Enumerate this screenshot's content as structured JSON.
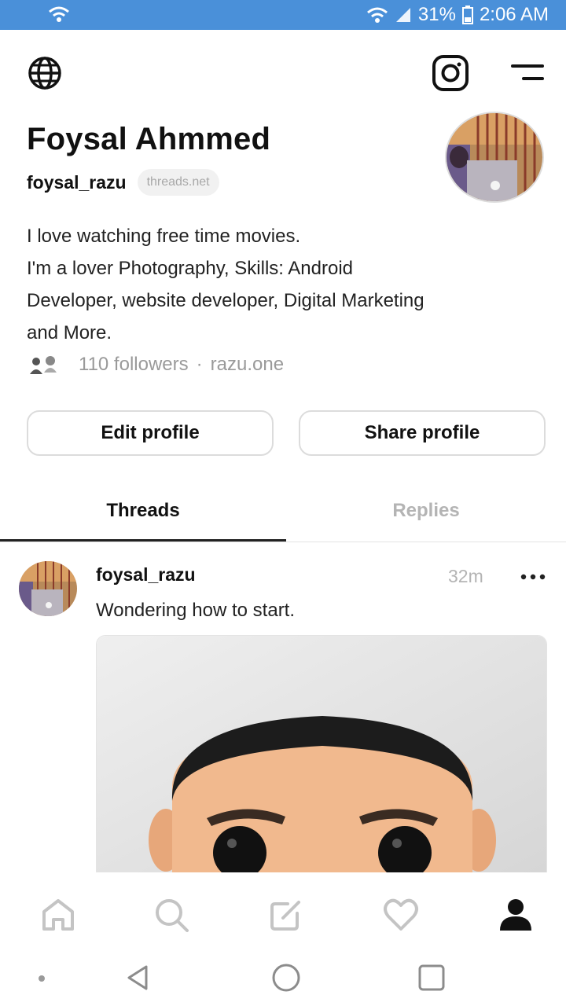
{
  "status_bar": {
    "battery": "31%",
    "time": "2:06 AM",
    "background": "#4a90d9"
  },
  "top_bar": {
    "left_icon": "globe-icon",
    "right_icons": [
      "instagram-icon",
      "menu-icon"
    ]
  },
  "profile": {
    "name": "Foysal Ahmmed",
    "handle": "foysal_razu",
    "domain_chip": "threads.net",
    "bio_lines": [
      "I love watching free time movies.",
      "I'm a lover Photography, Skills: Android",
      "Developer, website developer, Digital Marketing",
      "and More."
    ],
    "followers": "110 followers",
    "separator": "·",
    "link": "razu.one"
  },
  "buttons": {
    "edit": "Edit profile",
    "share": "Share profile"
  },
  "tabs": [
    {
      "label": "Threads",
      "active": true
    },
    {
      "label": "Replies",
      "active": false
    }
  ],
  "post": {
    "username": "foysal_razu",
    "time": "32m",
    "text": "Wondering how to start."
  },
  "bottom_nav": [
    "home-icon",
    "search-icon",
    "compose-icon",
    "heart-icon",
    "profile-icon"
  ],
  "system_nav": [
    "dot-icon",
    "back-icon",
    "home-circle-icon",
    "recents-icon"
  ]
}
